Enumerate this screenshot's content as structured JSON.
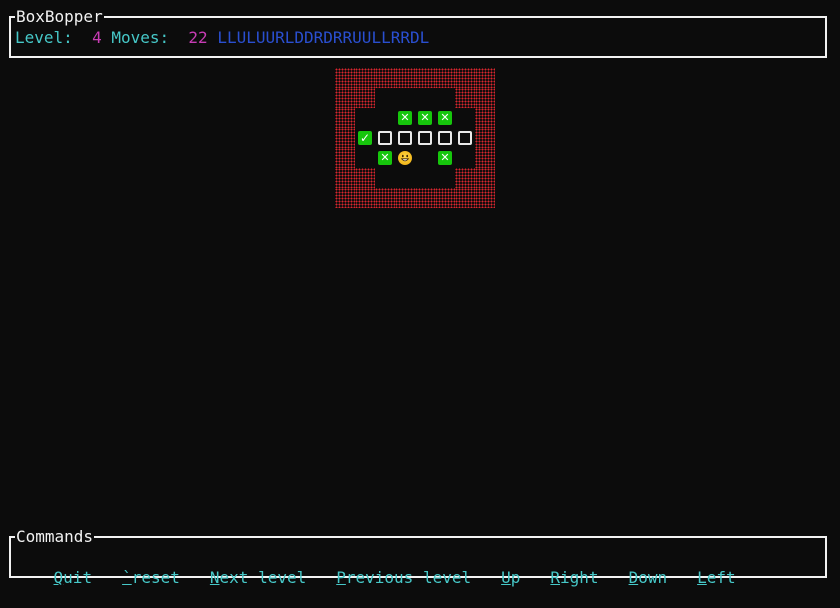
{
  "app": {
    "title": "BoxBopper"
  },
  "status": {
    "level_label": "Level:",
    "level_value": "4",
    "moves_label": "Moves:",
    "moves_value": "22",
    "move_history": "LLULUURLDDRDRRUULLRRDL"
  },
  "commands": {
    "title": "Commands",
    "items": [
      {
        "key": "Q",
        "rest": "uit"
      },
      {
        "key": "`",
        "rest": "reset"
      },
      {
        "key": "N",
        "rest": "ext level"
      },
      {
        "key": "P",
        "rest": "revious level"
      },
      {
        "key": "U",
        "rest": "p"
      },
      {
        "key": "R",
        "rest": "ight"
      },
      {
        "key": "D",
        "rest": "own"
      },
      {
        "key": "L",
        "rest": "eft"
      }
    ]
  },
  "board": {
    "legend": {
      "#": "wall-red-dotted",
      ".": "floor",
      "x": "target-green-x",
      "b": "box-white-outline",
      "c": "box-on-target-green-check",
      "@": "player-smiley",
      " ": "outside"
    },
    "rows": [
      "########",
      "##....##",
      "#..xxx.#",
      "#cbbbbb#",
      "#.x@.x.#",
      "##....##",
      "########"
    ],
    "colors": {
      "wall": "#d8262e",
      "target": "#16c60c",
      "box_border": "#e8e8e8",
      "player": "#f3b81c"
    }
  },
  "colors": {
    "background": "#0c0c0c",
    "border": "#f2f2f2",
    "label": "#46c8c8",
    "value": "#c83cb4",
    "history": "#2a4fd0"
  }
}
